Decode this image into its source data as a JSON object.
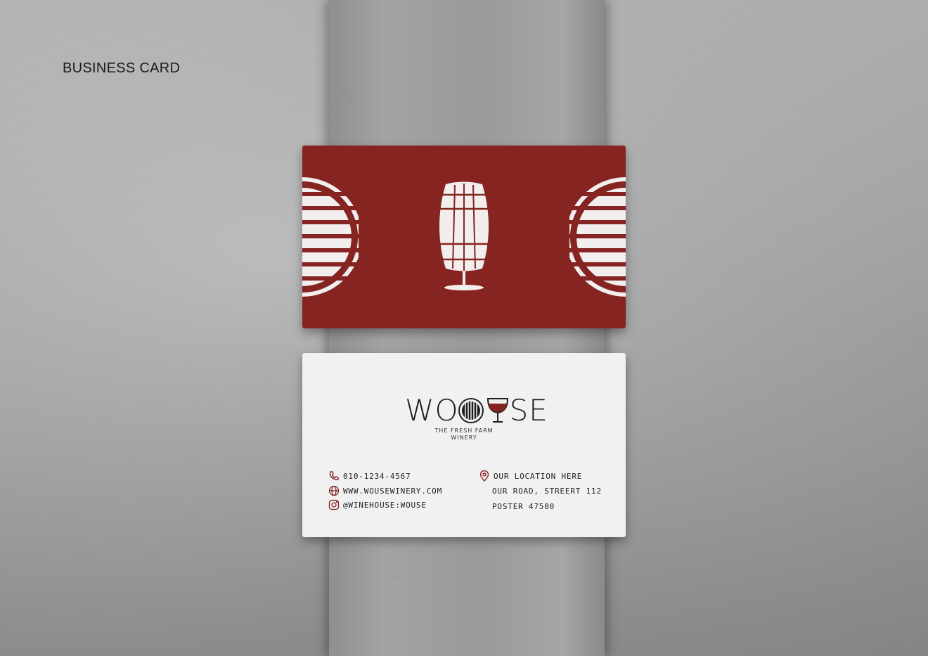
{
  "heading": "BUSINESS CARD",
  "colors": {
    "brand_red": "#862421",
    "card_white": "#f1f1f1",
    "ink": "#222222"
  },
  "card_front": {
    "emblem_icon": "barrel-wineglass-icon",
    "side_ornament": "half-circle-stripes"
  },
  "card_back": {
    "logo": {
      "text_left": "WO",
      "text_right": "SE",
      "barrel_icon": "barrel-icon",
      "glass_icon": "wineglass-icon"
    },
    "tagline_line1": "THE FRESH FARM",
    "tagline_line2": "WINERY",
    "contacts": [
      {
        "icon": "phone-icon",
        "text": "010-1234-4567"
      },
      {
        "icon": "globe-icon",
        "text": "WWW.WOUSEWINERY.COM"
      },
      {
        "icon": "instagram-icon",
        "text": "@WINEHOUSE:WOUSE"
      }
    ],
    "location": {
      "icon": "location-pin-icon",
      "title": "OUR LOCATION HERE",
      "line1": "OUR ROAD, STREERT 112",
      "line2": "POSTER 47500"
    }
  }
}
